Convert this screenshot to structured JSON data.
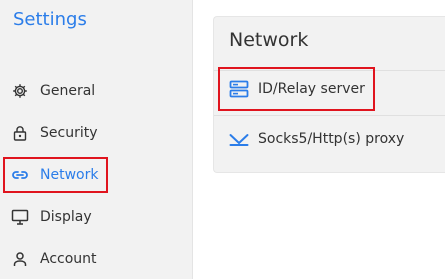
{
  "app": {
    "title": "Settings"
  },
  "sidebar": {
    "items": [
      {
        "label": "General",
        "icon": "gear-icon",
        "active": false
      },
      {
        "label": "Security",
        "icon": "lock-icon",
        "active": false
      },
      {
        "label": "Network",
        "icon": "link-icon",
        "active": true
      },
      {
        "label": "Display",
        "icon": "monitor-icon",
        "active": false
      },
      {
        "label": "Account",
        "icon": "person-icon",
        "active": false
      }
    ]
  },
  "main": {
    "panel_title": "Network",
    "options": [
      {
        "label": "ID/Relay server",
        "icon": "server-icon"
      },
      {
        "label": "Socks5/Http(s) proxy",
        "icon": "proxy-icon"
      }
    ]
  },
  "colors": {
    "accent": "#2b7de9",
    "highlight": "#e0141e",
    "sidebar_bg": "#f2f2f2",
    "text": "#333333"
  }
}
